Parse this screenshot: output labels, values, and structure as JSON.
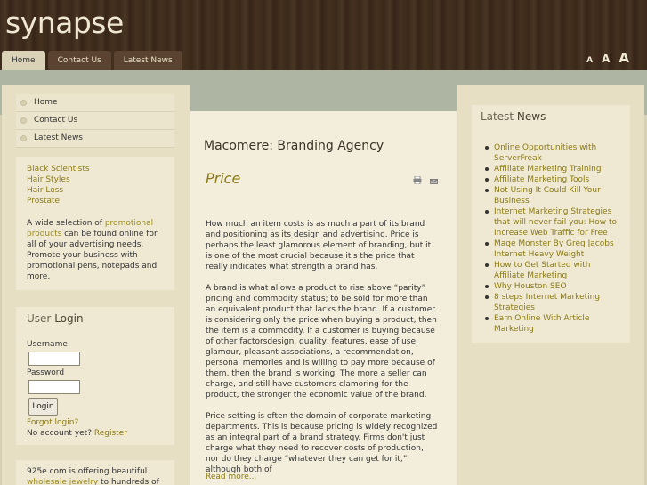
{
  "site": {
    "logo": "synapse"
  },
  "nav": {
    "items": [
      {
        "label": "Home",
        "active": true
      },
      {
        "label": "Contact Us",
        "active": false
      },
      {
        "label": "Latest News",
        "active": false
      }
    ]
  },
  "font_controls": [
    "A",
    "A",
    "A"
  ],
  "main_menu": [
    {
      "label": "Home"
    },
    {
      "label": "Contact Us"
    },
    {
      "label": "Latest News"
    }
  ],
  "links": [
    {
      "label": "Black Scientists"
    },
    {
      "label": "Hair Styles"
    },
    {
      "label": "Hair Loss"
    },
    {
      "label": "Prostate"
    }
  ],
  "promo": {
    "text_before": "A wide selection of ",
    "link_text": "promotional products",
    "text_after": " can be found online for all of your advertising needs. Promote your business with promotional pens, notepads and more."
  },
  "login": {
    "title_alt": "User",
    "title_strong": "Login",
    "username_label": "Username",
    "password_label": "Password",
    "button_label": "Login",
    "forgot_label": "Forgot login?",
    "no_account_text": "No account yet?",
    "register_label": "Register"
  },
  "bottom_promo": {
    "text_before": "925e.com is offering beautiful ",
    "link_text": "wholesale jewelry",
    "text_after": " to hundreds of"
  },
  "article": {
    "heading": "Macomere: Branding Agency",
    "title": "Price",
    "paragraphs": [
      "How much an item costs is as much a part of its brand and positioning as its design and advertising. Price is perhaps the least glamorous element of branding, but it is one of the most crucial because it's the price that really indicates what strength a brand has.",
      "A brand is what allows a product to rise above “parity” pricing and commodity status; to be sold for more than an equivalent product that lacks the brand. If a customer is considering only the price when buying a product, then the item is a commodity. If a customer is buying because of other factorsdesign, quality, features, ease of use, glamour, pleasant associations, a recommendation, personal memories and is willing to pay more because of them, then the brand is working. The more a seller can charge, and still have customers clamoring for the product, the stronger the economic value of the brand.",
      "Price setting is often the domain of corporate marketing departments. This is because pricing is widely recognized as an integral part of a brand strategy. Firms don't just charge what they need to recover costs of production, nor do they charge “whatever they can get for it,” although both of"
    ],
    "read_more": "Read more..."
  },
  "latest_news": {
    "title_alt": "Latest",
    "title_strong": "News",
    "items": [
      "Online Opportunities with ServerFreak",
      "Affiliate Marketing Training",
      "Affiliate Marketing Tools",
      "Not Using It Could Kill Your Business",
      "Internet Marketing Strategies that will never fail you: How to Increase Web Traffic for Free",
      "Mage Monster By Greg Jacobs Internet Heavy Weight",
      "How to Get Started with Affiliate Marketing",
      "Why Houston SEO",
      "8 steps Internet Marketing Strategies",
      "Earn Online With Article Marketing"
    ]
  }
}
